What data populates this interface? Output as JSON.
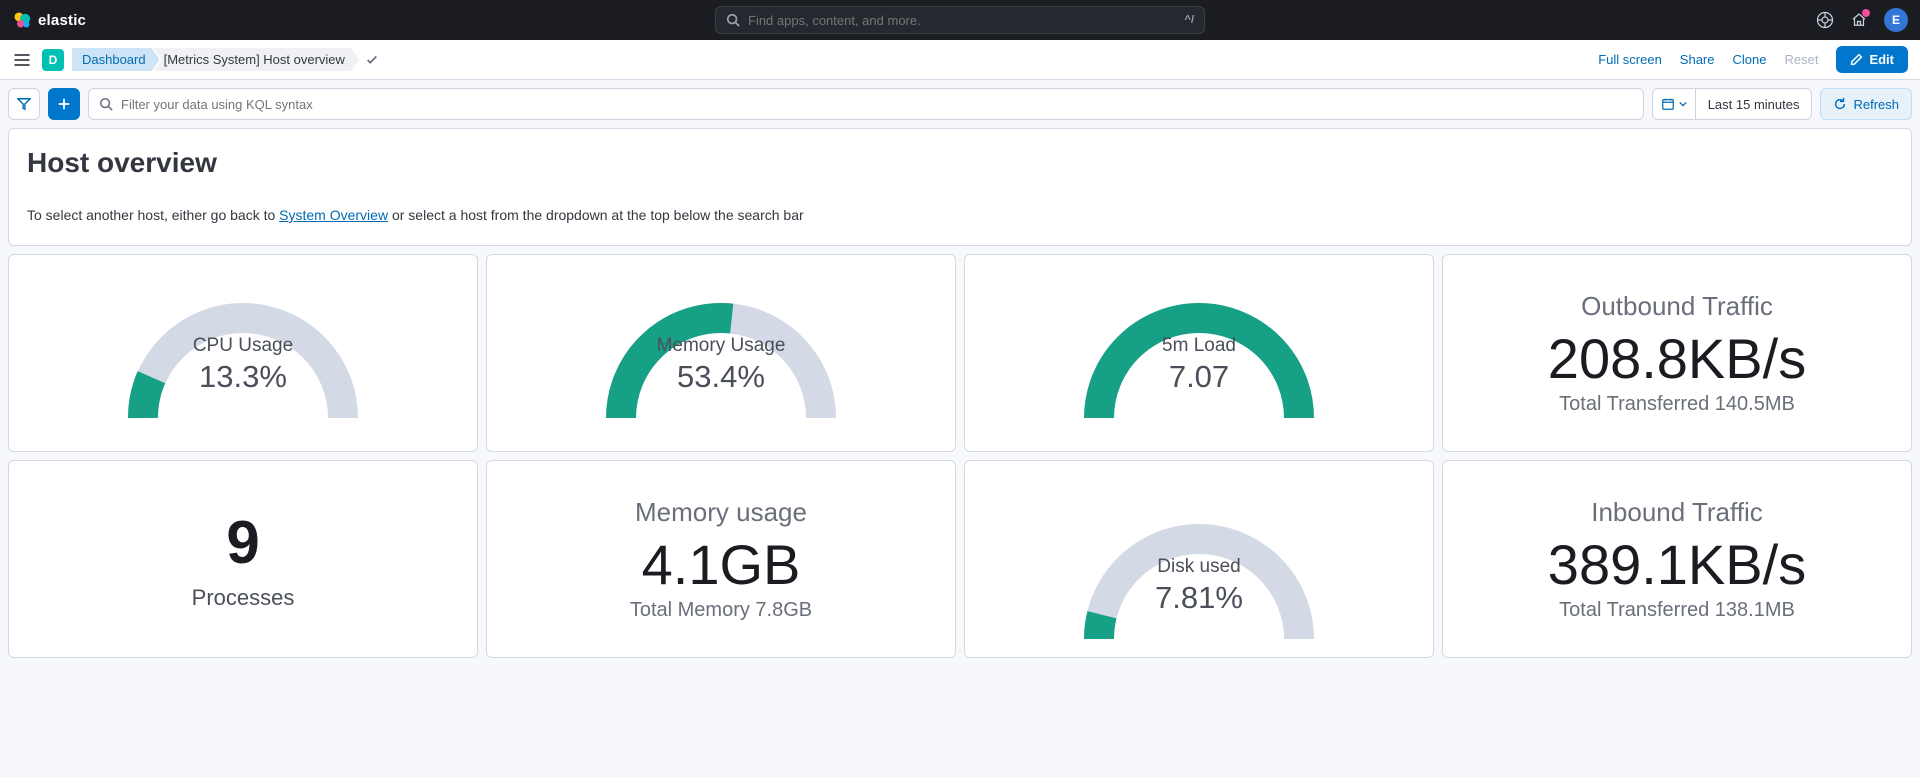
{
  "header": {
    "brand": "elastic",
    "search_placeholder": "Find apps, content, and more.",
    "search_shortcut": "^/",
    "avatar_initial": "E"
  },
  "subheader": {
    "badge_letter": "D",
    "breadcrumb_root": "Dashboard",
    "breadcrumb_current": "[Metrics System] Host overview",
    "full_screen": "Full screen",
    "share": "Share",
    "clone": "Clone",
    "reset": "Reset",
    "edit": "Edit"
  },
  "querybar": {
    "placeholder": "Filter your data using KQL syntax",
    "time_range": "Last 15 minutes",
    "refresh": "Refresh"
  },
  "intro": {
    "title": "Host overview",
    "text_pre": "To select another host, either go back to ",
    "link": "System Overview",
    "text_post": " or select a host from the dropdown at the top below the search bar"
  },
  "panels": {
    "cpu": {
      "title": "CPU Usage",
      "value": "13.3%"
    },
    "memory": {
      "title": "Memory Usage",
      "value": "53.4%"
    },
    "load5m": {
      "title": "5m Load",
      "value": "7.07"
    },
    "outbound": {
      "title": "Outbound Traffic",
      "value": "208.8KB/s",
      "sub": "Total Transferred 140.5MB"
    },
    "processes": {
      "value": "9",
      "label": "Processes"
    },
    "mem_usage": {
      "title": "Memory usage",
      "value": "4.1GB",
      "sub": "Total Memory 7.8GB"
    },
    "disk": {
      "title": "Disk used",
      "value": "7.81%"
    },
    "inbound": {
      "title": "Inbound Traffic",
      "value": "389.1KB/s",
      "sub": "Total Transferred 138.1MB"
    }
  },
  "chart_data": [
    {
      "type": "bar",
      "title": "CPU Usage",
      "categories": [
        "CPU Usage"
      ],
      "values": [
        13.3
      ],
      "ylim": [
        0,
        100
      ],
      "unit": "%"
    },
    {
      "type": "bar",
      "title": "Memory Usage",
      "categories": [
        "Memory Usage"
      ],
      "values": [
        53.4
      ],
      "ylim": [
        0,
        100
      ],
      "unit": "%"
    },
    {
      "type": "bar",
      "title": "5m Load",
      "categories": [
        "5m Load"
      ],
      "values": [
        7.07
      ],
      "ylim": [
        0,
        7.07
      ]
    },
    {
      "type": "bar",
      "title": "Disk used",
      "categories": [
        "Disk used"
      ],
      "values": [
        7.81
      ],
      "ylim": [
        0,
        100
      ],
      "unit": "%"
    }
  ],
  "colors": {
    "accent": "#0077cc",
    "gauge_fill": "#16a085",
    "gauge_track": "#d3dae6"
  }
}
